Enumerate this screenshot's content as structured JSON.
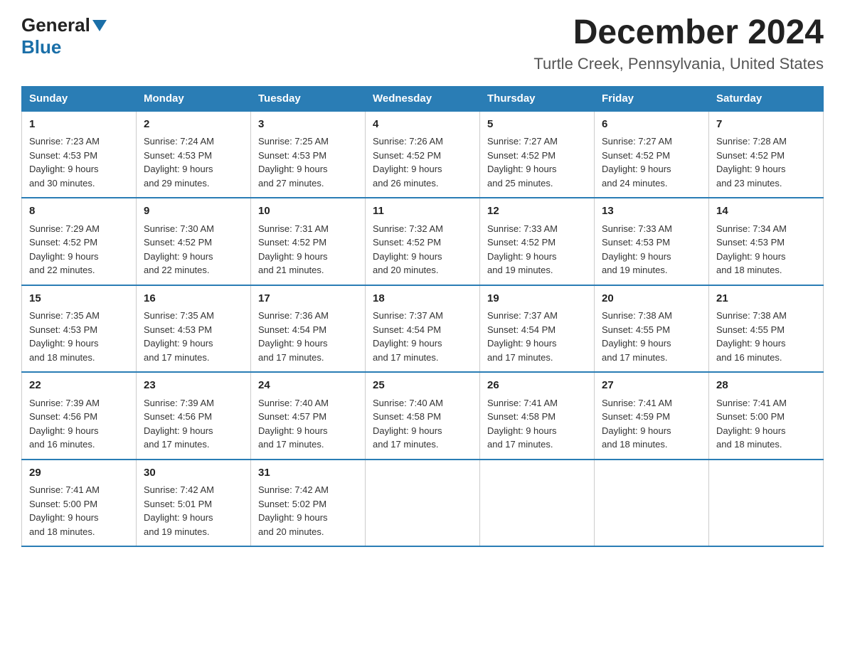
{
  "header": {
    "logo_general": "General",
    "logo_blue": "Blue",
    "main_title": "December 2024",
    "subtitle": "Turtle Creek, Pennsylvania, United States"
  },
  "weekdays": [
    "Sunday",
    "Monday",
    "Tuesday",
    "Wednesday",
    "Thursday",
    "Friday",
    "Saturday"
  ],
  "weeks": [
    [
      {
        "day": "1",
        "sunrise": "7:23 AM",
        "sunset": "4:53 PM",
        "daylight": "9 hours and 30 minutes."
      },
      {
        "day": "2",
        "sunrise": "7:24 AM",
        "sunset": "4:53 PM",
        "daylight": "9 hours and 29 minutes."
      },
      {
        "day": "3",
        "sunrise": "7:25 AM",
        "sunset": "4:53 PM",
        "daylight": "9 hours and 27 minutes."
      },
      {
        "day": "4",
        "sunrise": "7:26 AM",
        "sunset": "4:52 PM",
        "daylight": "9 hours and 26 minutes."
      },
      {
        "day": "5",
        "sunrise": "7:27 AM",
        "sunset": "4:52 PM",
        "daylight": "9 hours and 25 minutes."
      },
      {
        "day": "6",
        "sunrise": "7:27 AM",
        "sunset": "4:52 PM",
        "daylight": "9 hours and 24 minutes."
      },
      {
        "day": "7",
        "sunrise": "7:28 AM",
        "sunset": "4:52 PM",
        "daylight": "9 hours and 23 minutes."
      }
    ],
    [
      {
        "day": "8",
        "sunrise": "7:29 AM",
        "sunset": "4:52 PM",
        "daylight": "9 hours and 22 minutes."
      },
      {
        "day": "9",
        "sunrise": "7:30 AM",
        "sunset": "4:52 PM",
        "daylight": "9 hours and 22 minutes."
      },
      {
        "day": "10",
        "sunrise": "7:31 AM",
        "sunset": "4:52 PM",
        "daylight": "9 hours and 21 minutes."
      },
      {
        "day": "11",
        "sunrise": "7:32 AM",
        "sunset": "4:52 PM",
        "daylight": "9 hours and 20 minutes."
      },
      {
        "day": "12",
        "sunrise": "7:33 AM",
        "sunset": "4:52 PM",
        "daylight": "9 hours and 19 minutes."
      },
      {
        "day": "13",
        "sunrise": "7:33 AM",
        "sunset": "4:53 PM",
        "daylight": "9 hours and 19 minutes."
      },
      {
        "day": "14",
        "sunrise": "7:34 AM",
        "sunset": "4:53 PM",
        "daylight": "9 hours and 18 minutes."
      }
    ],
    [
      {
        "day": "15",
        "sunrise": "7:35 AM",
        "sunset": "4:53 PM",
        "daylight": "9 hours and 18 minutes."
      },
      {
        "day": "16",
        "sunrise": "7:35 AM",
        "sunset": "4:53 PM",
        "daylight": "9 hours and 17 minutes."
      },
      {
        "day": "17",
        "sunrise": "7:36 AM",
        "sunset": "4:54 PM",
        "daylight": "9 hours and 17 minutes."
      },
      {
        "day": "18",
        "sunrise": "7:37 AM",
        "sunset": "4:54 PM",
        "daylight": "9 hours and 17 minutes."
      },
      {
        "day": "19",
        "sunrise": "7:37 AM",
        "sunset": "4:54 PM",
        "daylight": "9 hours and 17 minutes."
      },
      {
        "day": "20",
        "sunrise": "7:38 AM",
        "sunset": "4:55 PM",
        "daylight": "9 hours and 17 minutes."
      },
      {
        "day": "21",
        "sunrise": "7:38 AM",
        "sunset": "4:55 PM",
        "daylight": "9 hours and 16 minutes."
      }
    ],
    [
      {
        "day": "22",
        "sunrise": "7:39 AM",
        "sunset": "4:56 PM",
        "daylight": "9 hours and 16 minutes."
      },
      {
        "day": "23",
        "sunrise": "7:39 AM",
        "sunset": "4:56 PM",
        "daylight": "9 hours and 17 minutes."
      },
      {
        "day": "24",
        "sunrise": "7:40 AM",
        "sunset": "4:57 PM",
        "daylight": "9 hours and 17 minutes."
      },
      {
        "day": "25",
        "sunrise": "7:40 AM",
        "sunset": "4:58 PM",
        "daylight": "9 hours and 17 minutes."
      },
      {
        "day": "26",
        "sunrise": "7:41 AM",
        "sunset": "4:58 PM",
        "daylight": "9 hours and 17 minutes."
      },
      {
        "day": "27",
        "sunrise": "7:41 AM",
        "sunset": "4:59 PM",
        "daylight": "9 hours and 18 minutes."
      },
      {
        "day": "28",
        "sunrise": "7:41 AM",
        "sunset": "5:00 PM",
        "daylight": "9 hours and 18 minutes."
      }
    ],
    [
      {
        "day": "29",
        "sunrise": "7:41 AM",
        "sunset": "5:00 PM",
        "daylight": "9 hours and 18 minutes."
      },
      {
        "day": "30",
        "sunrise": "7:42 AM",
        "sunset": "5:01 PM",
        "daylight": "9 hours and 19 minutes."
      },
      {
        "day": "31",
        "sunrise": "7:42 AM",
        "sunset": "5:02 PM",
        "daylight": "9 hours and 20 minutes."
      },
      null,
      null,
      null,
      null
    ]
  ],
  "labels": {
    "sunrise": "Sunrise:",
    "sunset": "Sunset:",
    "daylight": "Daylight:"
  }
}
